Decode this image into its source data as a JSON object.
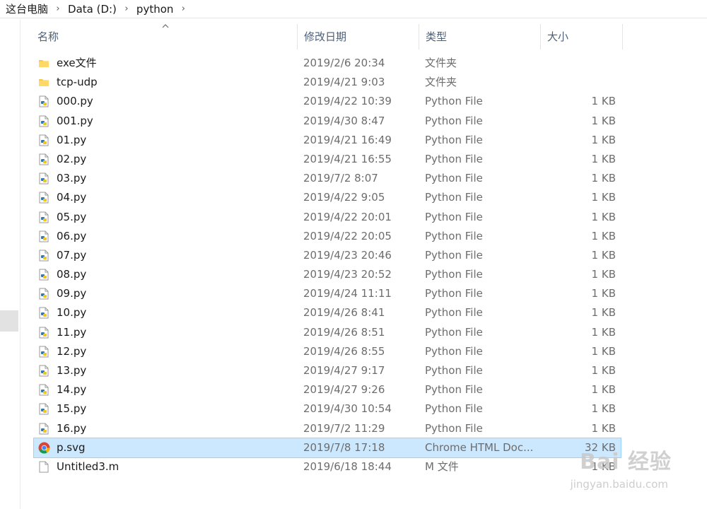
{
  "breadcrumb": {
    "items": [
      "这台电脑",
      "Data (D:)",
      "python"
    ],
    "separator": "›"
  },
  "columns": {
    "name": "名称",
    "date": "修改日期",
    "type": "类型",
    "size": "大小"
  },
  "files": [
    {
      "name": "exe文件",
      "date": "2019/2/6 20:34",
      "type": "文件夹",
      "size": "",
      "icon": "folder-icon"
    },
    {
      "name": "tcp-udp",
      "date": "2019/4/21 9:03",
      "type": "文件夹",
      "size": "",
      "icon": "folder-icon"
    },
    {
      "name": "000.py",
      "date": "2019/4/22 10:39",
      "type": "Python File",
      "size": "1 KB",
      "icon": "python-file-icon"
    },
    {
      "name": "001.py",
      "date": "2019/4/30 8:47",
      "type": "Python File",
      "size": "1 KB",
      "icon": "python-file-icon"
    },
    {
      "name": "01.py",
      "date": "2019/4/21 16:49",
      "type": "Python File",
      "size": "1 KB",
      "icon": "python-file-icon"
    },
    {
      "name": "02.py",
      "date": "2019/4/21 16:55",
      "type": "Python File",
      "size": "1 KB",
      "icon": "python-file-icon"
    },
    {
      "name": "03.py",
      "date": "2019/7/2 8:07",
      "type": "Python File",
      "size": "1 KB",
      "icon": "python-file-icon"
    },
    {
      "name": "04.py",
      "date": "2019/4/22 9:05",
      "type": "Python File",
      "size": "1 KB",
      "icon": "python-file-icon"
    },
    {
      "name": "05.py",
      "date": "2019/4/22 20:01",
      "type": "Python File",
      "size": "1 KB",
      "icon": "python-file-icon"
    },
    {
      "name": "06.py",
      "date": "2019/4/22 20:05",
      "type": "Python File",
      "size": "1 KB",
      "icon": "python-file-icon"
    },
    {
      "name": "07.py",
      "date": "2019/4/23 20:46",
      "type": "Python File",
      "size": "1 KB",
      "icon": "python-file-icon"
    },
    {
      "name": "08.py",
      "date": "2019/4/23 20:52",
      "type": "Python File",
      "size": "1 KB",
      "icon": "python-file-icon"
    },
    {
      "name": "09.py",
      "date": "2019/4/24 11:11",
      "type": "Python File",
      "size": "1 KB",
      "icon": "python-file-icon"
    },
    {
      "name": "10.py",
      "date": "2019/4/26 8:41",
      "type": "Python File",
      "size": "1 KB",
      "icon": "python-file-icon"
    },
    {
      "name": "11.py",
      "date": "2019/4/26 8:51",
      "type": "Python File",
      "size": "1 KB",
      "icon": "python-file-icon"
    },
    {
      "name": "12.py",
      "date": "2019/4/26 8:55",
      "type": "Python File",
      "size": "1 KB",
      "icon": "python-file-icon"
    },
    {
      "name": "13.py",
      "date": "2019/4/27 9:17",
      "type": "Python File",
      "size": "1 KB",
      "icon": "python-file-icon"
    },
    {
      "name": "14.py",
      "date": "2019/4/27 9:26",
      "type": "Python File",
      "size": "1 KB",
      "icon": "python-file-icon"
    },
    {
      "name": "15.py",
      "date": "2019/4/30 10:54",
      "type": "Python File",
      "size": "1 KB",
      "icon": "python-file-icon"
    },
    {
      "name": "16.py",
      "date": "2019/7/2 11:29",
      "type": "Python File",
      "size": "1 KB",
      "icon": "python-file-icon"
    },
    {
      "name": "p.svg",
      "date": "2019/7/8 17:18",
      "type": "Chrome HTML Doc...",
      "size": "32 KB",
      "icon": "chrome-icon",
      "selected": true
    },
    {
      "name": "Untitled3.m",
      "date": "2019/6/18 18:44",
      "type": "M 文件",
      "size": "1 KB",
      "icon": "blank-file-icon"
    }
  ],
  "watermark": {
    "text": "Bai 经验",
    "sub": "jingyan.baidu.com"
  },
  "colors": {
    "selected_bg": "#cce8ff",
    "selected_border": "#99d1ff",
    "header_text": "#4c607a",
    "folder": "#f8c93e"
  }
}
